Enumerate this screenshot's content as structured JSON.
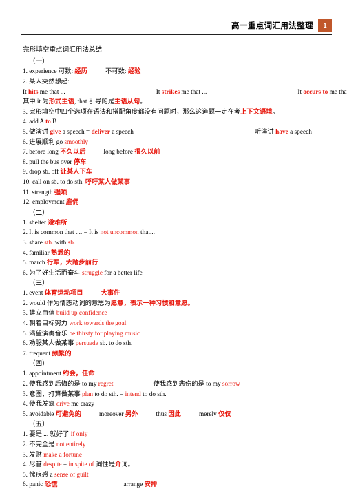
{
  "header": {
    "title": "高一重点词汇用法整理",
    "page_number": "1",
    "accent_color": "#c0572b"
  },
  "document": {
    "title": "完形填空重点词汇用法总结",
    "emphasis_color": "#e8170d"
  },
  "sections": [
    {
      "heading": "（一）",
      "entries": [
        {
          "index": "1.",
          "parts": [
            {
              "t": "experience  可数: ",
              "s": "plain"
            },
            {
              "t": "经历",
              "s": "rb"
            },
            {
              "t": "",
              "s": "gap-sm"
            },
            {
              "t": "不可数: ",
              "s": "plain"
            },
            {
              "t": "经验",
              "s": "rb"
            }
          ]
        },
        {
          "index": "2.",
          "parts": [
            {
              "t": "某人突然想起:",
              "s": "plain"
            }
          ]
        },
        {
          "index": "",
          "parts": [
            {
              "t": "It ",
              "s": "plain"
            },
            {
              "t": "hits",
              "s": "rb"
            },
            {
              "t": " me that ...",
              "s": "plain"
            },
            {
              "t": "",
              "s": "gap-xl"
            },
            {
              "t": "It ",
              "s": "plain"
            },
            {
              "t": "strikes",
              "s": "rb"
            },
            {
              "t": " me that ...",
              "s": "plain"
            },
            {
              "t": "",
              "s": "gap-xl"
            },
            {
              "t": "It ",
              "s": "plain"
            },
            {
              "t": "occurs to",
              "s": "rb"
            },
            {
              "t": " me that ...",
              "s": "plain"
            }
          ]
        },
        {
          "index": "",
          "parts": [
            {
              "t": "其中 it 为",
              "s": "plain"
            },
            {
              "t": "形式主语",
              "s": "rb"
            },
            {
              "t": ", that 引导的是",
              "s": "plain"
            },
            {
              "t": "主语从句",
              "s": "rb"
            },
            {
              "t": "。",
              "s": "plain"
            }
          ]
        },
        {
          "index": "3.",
          "parts": [
            {
              "t": "完形填空中四个选项在语法和搭配角度都没有问题时，那么这道题一定在考",
              "s": "plain"
            },
            {
              "t": "上下文语境",
              "s": "rb"
            },
            {
              "t": "。",
              "s": "plain"
            }
          ]
        },
        {
          "index": "4.",
          "parts": [
            {
              "t": "add A ",
              "s": "plain"
            },
            {
              "t": "to",
              "s": "rb"
            },
            {
              "t": " B",
              "s": "plain"
            }
          ]
        },
        {
          "index": "5.",
          "parts": [
            {
              "t": "做演讲  ",
              "s": "plain"
            },
            {
              "t": "give",
              "s": "rb"
            },
            {
              "t": " a speech = ",
              "s": "plain"
            },
            {
              "t": "deliver",
              "s": "rb"
            },
            {
              "t": " a speech",
              "s": "plain"
            },
            {
              "t": "",
              "s": "gap-xxl"
            },
            {
              "t": "听演讲  ",
              "s": "plain"
            },
            {
              "t": "have",
              "s": "rb"
            },
            {
              "t": " a speech",
              "s": "plain"
            }
          ]
        },
        {
          "index": "6.",
          "parts": [
            {
              "t": "进展顺利  go ",
              "s": "plain"
            },
            {
              "t": "smoothly",
              "s": "r"
            }
          ]
        },
        {
          "index": "7.",
          "parts": [
            {
              "t": "before long  ",
              "s": "plain"
            },
            {
              "t": "不久以后",
              "s": "rb"
            },
            {
              "t": "",
              "s": "gap-sm"
            },
            {
              "t": "long before  ",
              "s": "plain"
            },
            {
              "t": "很久以前",
              "s": "rb"
            }
          ]
        },
        {
          "index": "8.",
          "parts": [
            {
              "t": "pull the bus over  ",
              "s": "plain"
            },
            {
              "t": "停车",
              "s": "rb"
            }
          ]
        },
        {
          "index": "9.",
          "parts": [
            {
              "t": "drop sb. off  ",
              "s": "plain"
            },
            {
              "t": "让某人下车",
              "s": "rb"
            }
          ]
        },
        {
          "index": "10.",
          "parts": [
            {
              "t": "call on sb. to do sth.  ",
              "s": "plain"
            },
            {
              "t": "呼吁某人做某事",
              "s": "rb"
            }
          ]
        },
        {
          "index": "11.",
          "parts": [
            {
              "t": "strength  ",
              "s": "plain"
            },
            {
              "t": "强项",
              "s": "rb"
            }
          ]
        },
        {
          "index": "12.",
          "parts": [
            {
              "t": "employment  ",
              "s": "plain"
            },
            {
              "t": "雇佣",
              "s": "rb"
            }
          ]
        }
      ]
    },
    {
      "heading": "（二）",
      "entries": [
        {
          "index": "1.",
          "parts": [
            {
              "t": "shelter  ",
              "s": "plain"
            },
            {
              "t": "避难所",
              "s": "rb"
            }
          ]
        },
        {
          "index": "2.",
          "parts": [
            {
              "t": "It is common that .... = It is ",
              "s": "plain"
            },
            {
              "t": "not uncommon",
              "s": "r"
            },
            {
              "t": " that...",
              "s": "plain"
            }
          ]
        },
        {
          "index": "3.",
          "parts": [
            {
              "t": "share ",
              "s": "plain"
            },
            {
              "t": "sth.",
              "s": "r"
            },
            {
              "t": " with ",
              "s": "plain"
            },
            {
              "t": "sb.",
              "s": "r"
            },
            {
              "t": "",
              "s": "plain"
            }
          ]
        },
        {
          "index": "4.",
          "parts": [
            {
              "t": "familiar  ",
              "s": "plain"
            },
            {
              "t": "熟悉的",
              "s": "rb"
            }
          ]
        },
        {
          "index": "5.",
          "parts": [
            {
              "t": "march  ",
              "s": "plain"
            },
            {
              "t": "行军，大踏步前行",
              "s": "rb"
            }
          ]
        },
        {
          "index": "6.",
          "parts": [
            {
              "t": "为了好生活而奋斗  ",
              "s": "plain"
            },
            {
              "t": "struggle",
              "s": "r"
            },
            {
              "t": " for a better life",
              "s": "plain"
            }
          ]
        }
      ]
    },
    {
      "heading": "（三）",
      "entries": [
        {
          "index": "1.",
          "parts": [
            {
              "t": "event  ",
              "s": "plain"
            },
            {
              "t": "体育运动项目",
              "s": "rb"
            },
            {
              "t": "",
              "s": "gap-sm"
            },
            {
              "t": "大事件",
              "s": "rb"
            }
          ]
        },
        {
          "index": "2.",
          "parts": [
            {
              "t": "would  作为情态动词的意思为",
              "s": "plain"
            },
            {
              "t": "愿意，表示一种习惯和意愿。",
              "s": "rb"
            }
          ]
        },
        {
          "index": "3.",
          "parts": [
            {
              "t": "建立自信  ",
              "s": "plain"
            },
            {
              "t": "build up confidence",
              "s": "r"
            }
          ]
        },
        {
          "index": "4.",
          "parts": [
            {
              "t": "朝着目标努力  ",
              "s": "plain"
            },
            {
              "t": "work towards the goal",
              "s": "r"
            }
          ]
        },
        {
          "index": "5.",
          "parts": [
            {
              "t": "渴望演奏音乐  ",
              "s": "plain"
            },
            {
              "t": "be thirsty for playing music",
              "s": "r"
            }
          ]
        },
        {
          "index": "6.",
          "parts": [
            {
              "t": "劝服某人做某事  ",
              "s": "plain"
            },
            {
              "t": "persuade",
              "s": "r"
            },
            {
              "t": " sb. to do sth.",
              "s": "plain"
            }
          ]
        },
        {
          "index": "7.",
          "parts": [
            {
              "t": "frequent  ",
              "s": "plain"
            },
            {
              "t": "频繁的",
              "s": "rb"
            }
          ]
        }
      ]
    },
    {
      "heading": "（四）",
      "entries": [
        {
          "index": "1.",
          "parts": [
            {
              "t": "appointment  ",
              "s": "plain"
            },
            {
              "t": "约会，任命",
              "s": "rb"
            }
          ]
        },
        {
          "index": "2.",
          "parts": [
            {
              "t": "使我感到后悔的是  to my ",
              "s": "plain"
            },
            {
              "t": "regret",
              "s": "r"
            },
            {
              "t": "",
              "s": "gap-md"
            },
            {
              "t": "使我感到悲伤的是  to my ",
              "s": "plain"
            },
            {
              "t": "sorrow",
              "s": "r"
            }
          ]
        },
        {
          "index": "3.",
          "parts": [
            {
              "t": "意图，打算做某事  ",
              "s": "plain"
            },
            {
              "t": "plan",
              "s": "r"
            },
            {
              "t": " to do sth. = ",
              "s": "plain"
            },
            {
              "t": "intend",
              "s": "r"
            },
            {
              "t": " to do sth.",
              "s": "plain"
            }
          ]
        },
        {
          "index": "4.",
          "parts": [
            {
              "t": "使我发疯  ",
              "s": "plain"
            },
            {
              "t": "drive",
              "s": "r"
            },
            {
              "t": " me crazy",
              "s": "plain"
            }
          ]
        },
        {
          "index": "5.",
          "parts": [
            {
              "t": "avoidable  ",
              "s": "plain"
            },
            {
              "t": "可避免的",
              "s": "rb"
            },
            {
              "t": "",
              "s": "gap-sm"
            },
            {
              "t": "moreover  ",
              "s": "plain"
            },
            {
              "t": "另外",
              "s": "rb"
            },
            {
              "t": "",
              "s": "gap-sm"
            },
            {
              "t": "thus  ",
              "s": "plain"
            },
            {
              "t": "因此",
              "s": "rb"
            },
            {
              "t": "",
              "s": "gap-sm"
            },
            {
              "t": "merely  ",
              "s": "plain"
            },
            {
              "t": "仅仅",
              "s": "rb"
            }
          ]
        }
      ]
    },
    {
      "heading": "（五）",
      "entries": [
        {
          "index": "1.",
          "parts": [
            {
              "t": "要是 ... 就好了  ",
              "s": "plain"
            },
            {
              "t": "if only",
              "s": "r"
            }
          ]
        },
        {
          "index": "2.",
          "parts": [
            {
              "t": "不完全是  ",
              "s": "plain"
            },
            {
              "t": "not entirely",
              "s": "r"
            }
          ]
        },
        {
          "index": "3.",
          "parts": [
            {
              "t": "发财  ",
              "s": "plain"
            },
            {
              "t": "make a fortune",
              "s": "r"
            }
          ]
        },
        {
          "index": "4.",
          "parts": [
            {
              "t": "尽管  ",
              "s": "plain"
            },
            {
              "t": "despite",
              "s": "r"
            },
            {
              "t": " = ",
              "s": "plain"
            },
            {
              "t": "in spite of",
              "s": "r"
            },
            {
              "t": "  词性是",
              "s": "plain"
            },
            {
              "t": "介",
              "s": "rb"
            },
            {
              "t": "词。",
              "s": "plain"
            }
          ]
        },
        {
          "index": "5.",
          "parts": [
            {
              "t": "愧疚感  a ",
              "s": "plain"
            },
            {
              "t": "sense of guilt",
              "s": "r"
            }
          ]
        },
        {
          "index": "6.",
          "parts": [
            {
              "t": "panic ",
              "s": "plain"
            },
            {
              "t": "恐慌",
              "s": "rb"
            },
            {
              "t": "",
              "s": "gap-lg"
            },
            {
              "t": "arrange  ",
              "s": "plain"
            },
            {
              "t": "安排",
              "s": "rb"
            }
          ]
        }
      ]
    }
  ]
}
